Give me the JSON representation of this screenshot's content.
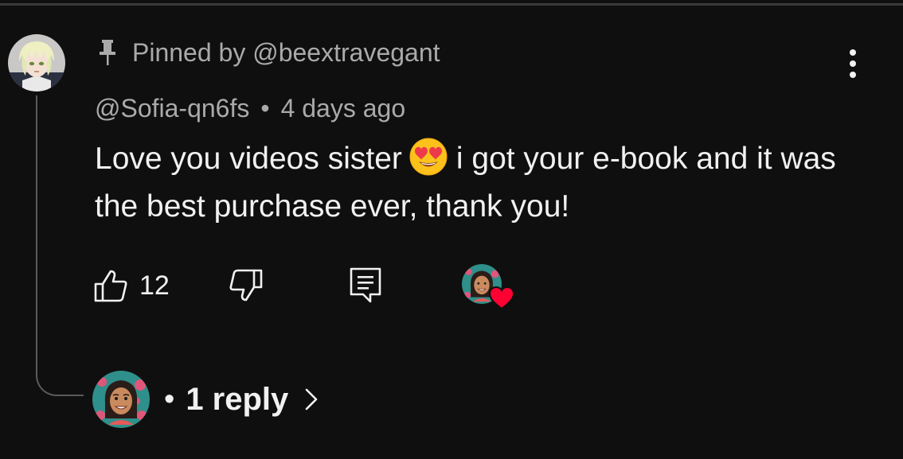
{
  "pinned": {
    "text": "Pinned by @beextravegant",
    "icon": "pin-icon"
  },
  "comment": {
    "author": "@Sofia-qn6fs",
    "separator": "•",
    "time": "4 days ago",
    "text_before_emoji": "Love you videos sister",
    "emoji": "heart-eyes-emoji",
    "text_after_emoji": "i got your e-book and it was the best purchase ever, thank you!"
  },
  "actions": {
    "like_icon": "thumbs-up-icon",
    "like_count": "12",
    "dislike_icon": "thumbs-down-icon",
    "reply_icon": "reply-comment-icon",
    "creator_heart_icon": "creator-heart-icon"
  },
  "replies": {
    "dot": "•",
    "label": "1 reply",
    "chevron_icon": "chevron-right-icon"
  },
  "colors": {
    "background": "#0f0f0f",
    "primary_text": "#f1f1f1",
    "secondary_text": "#aaaaaa",
    "heart": "#ff0033"
  }
}
